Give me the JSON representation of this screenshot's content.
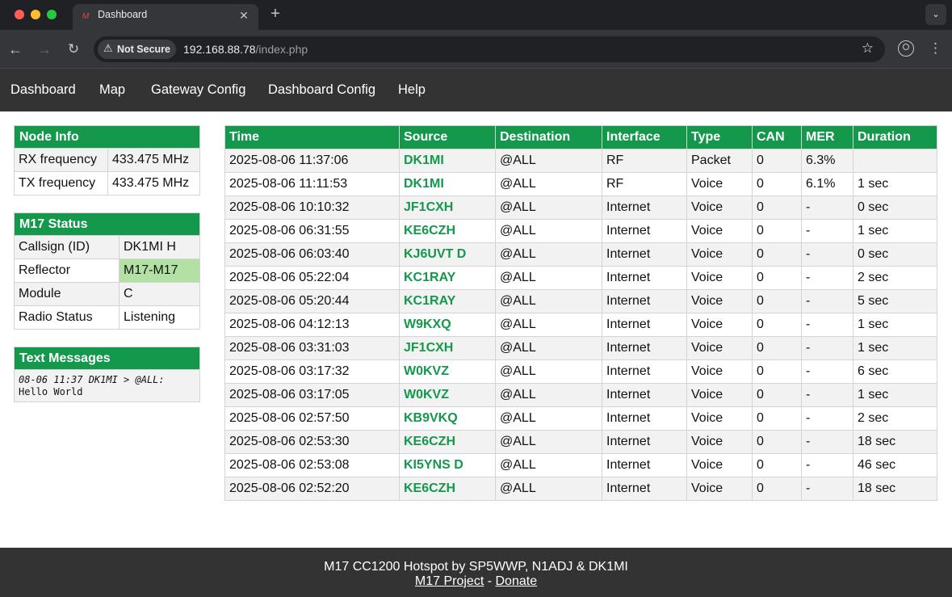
{
  "browser": {
    "tab_title": "Dashboard",
    "tab_close": "✕",
    "new_tab": "+",
    "tab_menu": "⌄",
    "security_label": "Not Secure",
    "url_host": "192.168.88.78",
    "url_path": "/index.php"
  },
  "nav": {
    "items": [
      "Dashboard",
      "Map",
      "Gateway Config",
      "Dashboard Config",
      "Help"
    ]
  },
  "node_info": {
    "title": "Node Info",
    "rows": [
      {
        "label": "RX frequency",
        "value": "433.475 MHz"
      },
      {
        "label": "TX frequency",
        "value": "433.475 MHz"
      }
    ]
  },
  "m17_status": {
    "title": "M17 Status",
    "rows": [
      {
        "label": "Callsign (ID)",
        "value": "DK1MI H"
      },
      {
        "label": "Reflector",
        "value": "M17-M17"
      },
      {
        "label": "Module",
        "value": "C"
      },
      {
        "label": "Radio Status",
        "value": "Listening"
      }
    ],
    "highlight_color": "#b3e0a3"
  },
  "text_messages": {
    "title": "Text Messages",
    "messages": [
      {
        "header": "08-06 11:37 DK1MI > @ALL:",
        "body": "Hello World"
      }
    ]
  },
  "last_heard": {
    "columns": [
      "Time",
      "Source",
      "Destination",
      "Interface",
      "Type",
      "CAN",
      "MER",
      "Duration"
    ],
    "rows": [
      [
        "2025-08-06 11:37:06",
        "DK1MI",
        "@ALL",
        "RF",
        "Packet",
        "0",
        "6.3%",
        ""
      ],
      [
        "2025-08-06 11:11:53",
        "DK1MI",
        "@ALL",
        "RF",
        "Voice",
        "0",
        "6.1%",
        "1 sec"
      ],
      [
        "2025-08-06 10:10:32",
        "JF1CXH",
        "@ALL",
        "Internet",
        "Voice",
        "0",
        "-",
        "0 sec"
      ],
      [
        "2025-08-06 06:31:55",
        "KE6CZH",
        "@ALL",
        "Internet",
        "Voice",
        "0",
        "-",
        "1 sec"
      ],
      [
        "2025-08-06 06:03:40",
        "KJ6UVT D",
        "@ALL",
        "Internet",
        "Voice",
        "0",
        "-",
        "0 sec"
      ],
      [
        "2025-08-06 05:22:04",
        "KC1RAY",
        "@ALL",
        "Internet",
        "Voice",
        "0",
        "-",
        "2 sec"
      ],
      [
        "2025-08-06 05:20:44",
        "KC1RAY",
        "@ALL",
        "Internet",
        "Voice",
        "0",
        "-",
        "5 sec"
      ],
      [
        "2025-08-06 04:12:13",
        "W9KXQ",
        "@ALL",
        "Internet",
        "Voice",
        "0",
        "-",
        "1 sec"
      ],
      [
        "2025-08-06 03:31:03",
        "JF1CXH",
        "@ALL",
        "Internet",
        "Voice",
        "0",
        "-",
        "1 sec"
      ],
      [
        "2025-08-06 03:17:32",
        "W0KVZ",
        "@ALL",
        "Internet",
        "Voice",
        "0",
        "-",
        "6 sec"
      ],
      [
        "2025-08-06 03:17:05",
        "W0KVZ",
        "@ALL",
        "Internet",
        "Voice",
        "0",
        "-",
        "1 sec"
      ],
      [
        "2025-08-06 02:57:50",
        "KB9VKQ",
        "@ALL",
        "Internet",
        "Voice",
        "0",
        "-",
        "2 sec"
      ],
      [
        "2025-08-06 02:53:30",
        "KE6CZH",
        "@ALL",
        "Internet",
        "Voice",
        "0",
        "-",
        "18 sec"
      ],
      [
        "2025-08-06 02:53:08",
        "KI5YNS D",
        "@ALL",
        "Internet",
        "Voice",
        "0",
        "-",
        "46 sec"
      ],
      [
        "2025-08-06 02:52:20",
        "KE6CZH",
        "@ALL",
        "Internet",
        "Voice",
        "0",
        "-",
        "18 sec"
      ]
    ]
  },
  "footer": {
    "credit": "M17 CC1200 Hotspot by SP5WWP, N1ADJ & DK1MI",
    "project_link": "M17 Project",
    "separator": " - ",
    "donate_link": "Donate"
  },
  "colors": {
    "header_green": "#14984c",
    "nav_bg": "#333333",
    "callsign_green": "#14984c"
  },
  "icons": [
    "warning-icon",
    "star-icon",
    "profile-icon",
    "kebab-menu-icon",
    "back-arrow-icon",
    "forward-arrow-icon",
    "reload-icon"
  ]
}
